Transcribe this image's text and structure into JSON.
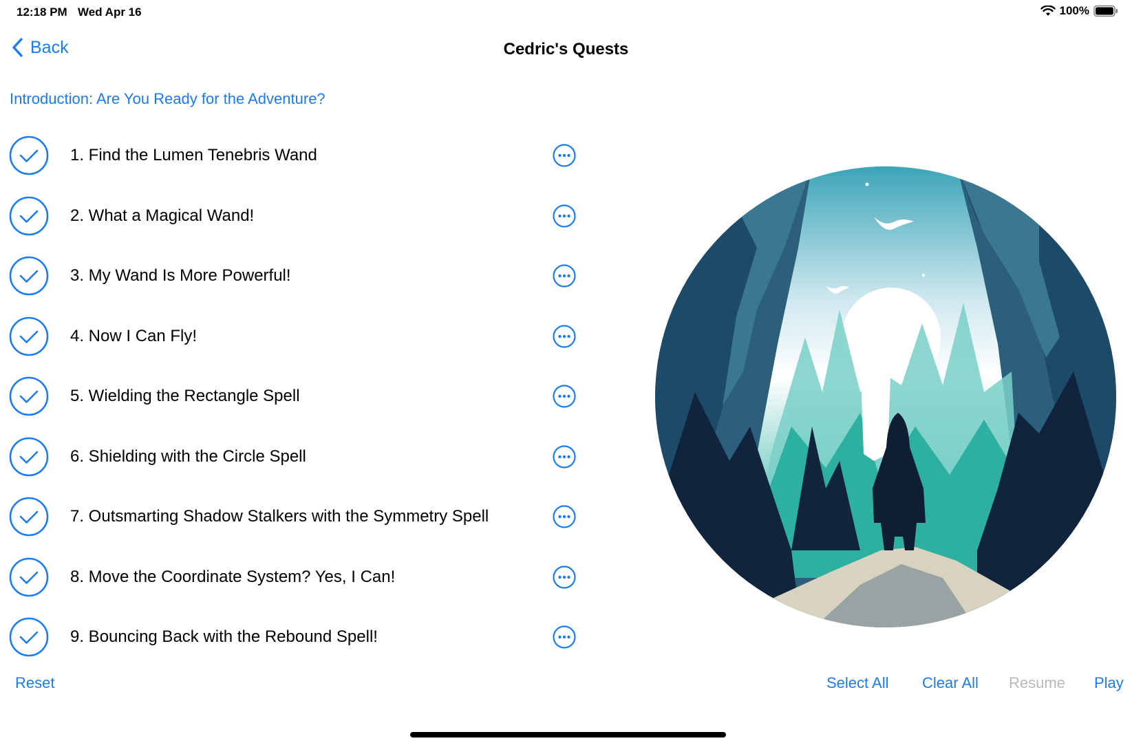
{
  "status": {
    "time": "12:18 PM",
    "date": "Wed Apr 16",
    "battery": "100%"
  },
  "nav": {
    "back_label": "Back",
    "title": "Cedric's Quests"
  },
  "intro": "Introduction: Are You Ready for the Adventure?",
  "quests": [
    {
      "label": "1. Find the Lumen Tenebris Wand",
      "checked": true
    },
    {
      "label": "2. What a Magical Wand!",
      "checked": true
    },
    {
      "label": "3. My Wand Is More Powerful!",
      "checked": true
    },
    {
      "label": "4. Now I Can Fly!",
      "checked": true
    },
    {
      "label": "5. Wielding the Rectangle Spell",
      "checked": true
    },
    {
      "label": "6. Shielding with the Circle Spell",
      "checked": true
    },
    {
      "label": "7. Outsmarting Shadow Stalkers with the Symmetry Spell",
      "checked": true
    },
    {
      "label": "8. Move the Coordinate System? Yes, I Can!",
      "checked": true
    },
    {
      "label": "9. Bouncing Back with the Rebound Spell!",
      "checked": true
    }
  ],
  "toolbar": {
    "reset": "Reset",
    "select_all": "Select All",
    "clear_all": "Clear All",
    "resume": "Resume",
    "play": "Play"
  },
  "colors": {
    "accent": "#1a7cf5",
    "disabled": "#b8b8bc"
  },
  "icons": {
    "check": "checkmark-circle-icon",
    "more": "ellipsis-circle-icon",
    "back": "chevron-left-icon"
  }
}
